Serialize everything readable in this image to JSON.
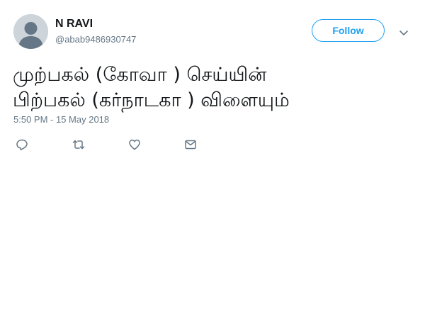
{
  "user": {
    "display_name": "N RAVI",
    "handle": "@abab9486930747",
    "avatar_icon": "default-avatar-icon"
  },
  "header": {
    "follow_label": "Follow",
    "more_icon": "chevron-down-icon"
  },
  "tweet": {
    "text": "முற்பகல் (கோவா ) செய்யின்\nபிற்பகல் (கர்நாடகா ) விளையும்",
    "timestamp": "5:50 PM - 15 May 2018"
  },
  "actions": {
    "reply_icon": "reply-icon",
    "retweet_icon": "retweet-icon",
    "like_icon": "heart-icon",
    "dm_icon": "envelope-icon"
  },
  "colors": {
    "accent": "#1da1f2",
    "text": "#14171a",
    "secondary": "#657786",
    "avatar_bg": "#cdd4da"
  }
}
